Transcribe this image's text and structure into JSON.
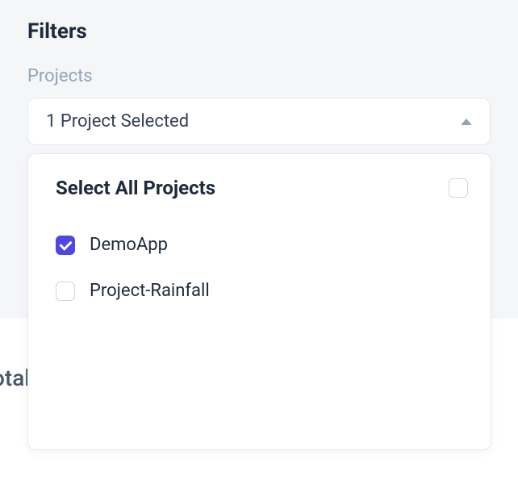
{
  "filters": {
    "title": "Filters",
    "projects_label": "Projects",
    "trigger_text": "1 Project Selected",
    "select_all_label": "Select All Projects",
    "options": [
      {
        "label": "DemoApp",
        "checked": true
      },
      {
        "label": "Project-Rainfall",
        "checked": false
      }
    ]
  },
  "partial": {
    "text": "otal"
  }
}
